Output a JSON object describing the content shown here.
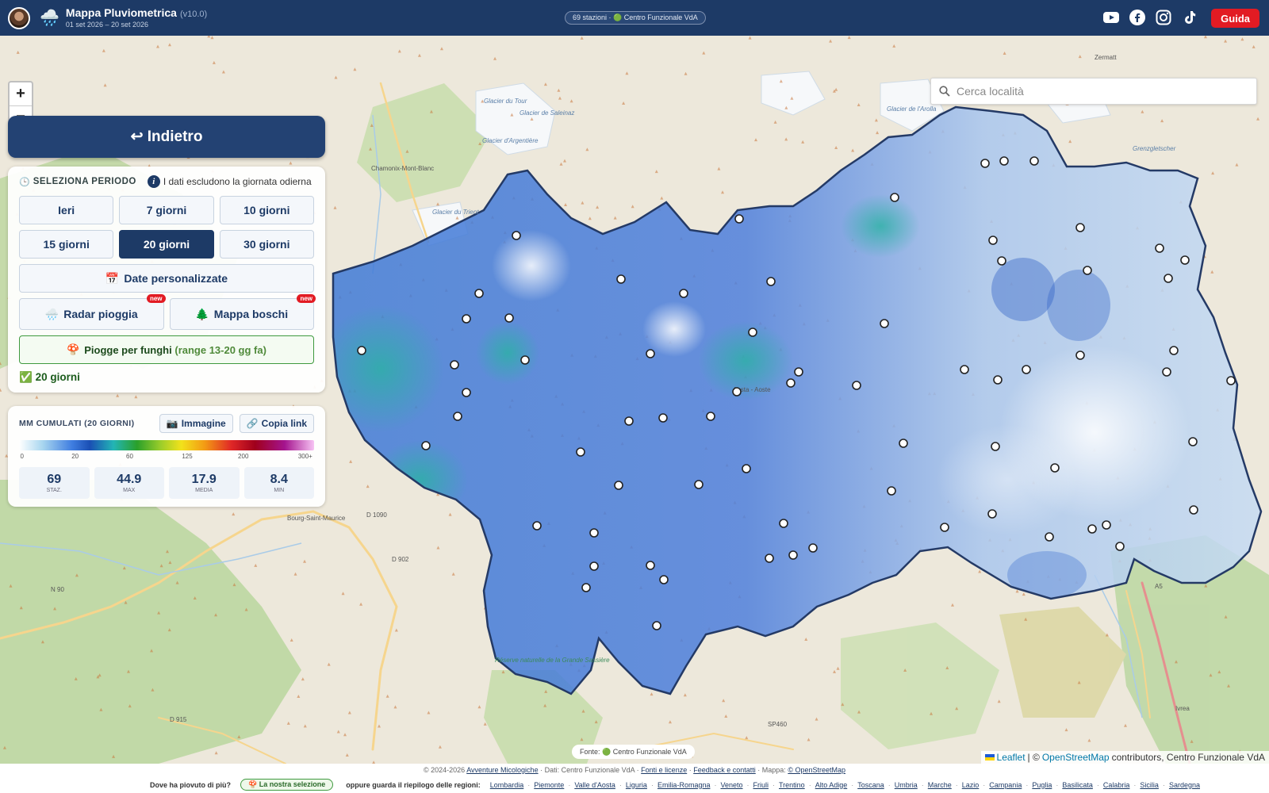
{
  "header": {
    "title": "Mappa Pluviometrica",
    "version": "(v10.0)",
    "dates": "01 set 2026 – 20 set 2026",
    "status": "69 stazioni · 🟢 Centro Funzionale VdA",
    "guide_label": "Guida",
    "social_icons": [
      "youtube-icon",
      "facebook-icon",
      "instagram-icon",
      "tiktok-icon"
    ]
  },
  "map": {
    "zoom_in": "+",
    "zoom_out": "−",
    "search_placeholder": "Cerca località",
    "place_labels": [
      "Zermatt",
      "Chamonix-Mont-Blanc",
      "Aosta - Aoste",
      "Bourg-Saint-Maurice",
      "Ivrea",
      "D 1090",
      "D 902",
      "N 90",
      "D 915",
      "SP460",
      "A5",
      "Réserve naturelle de la Grande Sassière",
      "Grenzgletscher",
      "Glacier du Tour",
      "Glacier de Saleinaz",
      "Glacier d'Argentière",
      "Glacier de l'Arolla",
      "Glacier du Trient"
    ],
    "colors": {
      "header": "#1d3a66",
      "accent_red": "#e21b23",
      "rain_blue": "#3f6fd6",
      "border": "#243a66"
    }
  },
  "back_button": "↩ Indietro",
  "period": {
    "title": "SELEZIONA PERIODO",
    "note": "I dati escludono la giornata odierna",
    "buttons": [
      "Ieri",
      "7 giorni",
      "10 giorni",
      "15 giorni",
      "20 giorni",
      "30 giorni"
    ],
    "active": "20 giorni",
    "custom_dates": "Date personalizzate",
    "radar": "Radar pioggia",
    "boschi": "Mappa boschi",
    "new_badge": "new",
    "funghi_label": "Piogge per funghi",
    "funghi_range": "(range 13-20 gg fa)",
    "selected_label": "20 giorni"
  },
  "legend": {
    "title": "MM CUMULATI (20 GIORNI)",
    "image_btn": "Immagine",
    "copy_btn": "Copia link",
    "ticks": [
      "0",
      "20",
      "60",
      "125",
      "200",
      "300+"
    ],
    "stats": [
      {
        "value": "69",
        "label": "STAZ."
      },
      {
        "value": "44.9",
        "label": "MAX"
      },
      {
        "value": "17.9",
        "label": "MEDIA"
      },
      {
        "value": "8.4",
        "label": "MIN"
      }
    ]
  },
  "attribution": {
    "fonte": "Fonte: 🟢 Centro Funzionale VdA",
    "leaflet": "Leaflet",
    "osm": "OpenStreetMap",
    "contrib": "contributors, Centro Funzionale VdA"
  },
  "footer": {
    "copyright": "© 2024-2026",
    "avventure": "Avventure Micologiche",
    "dati": "· Dati: Centro Funzionale VdA ·",
    "fonti": "Fonti e licenze",
    "feedback": "Feedback e contatti",
    "mappa": "· Mappa:",
    "osm": "© OpenStreetMap",
    "question": "Dove ha piovuto di più?",
    "nostra": "🍄 La nostra selezione",
    "oppure": "oppure guarda il riepilogo delle regioni:",
    "regions": [
      "Lombardia",
      "Piemonte",
      "Valle d'Aosta",
      "Liguria",
      "Emilia-Romagna",
      "Veneto",
      "Friuli",
      "Trentino",
      "Alto Adige",
      "Toscana",
      "Umbria",
      "Marche",
      "Lazio",
      "Campania",
      "Puglia",
      "Basilicata",
      "Calabria",
      "Sicilia",
      "Sardegna"
    ]
  }
}
